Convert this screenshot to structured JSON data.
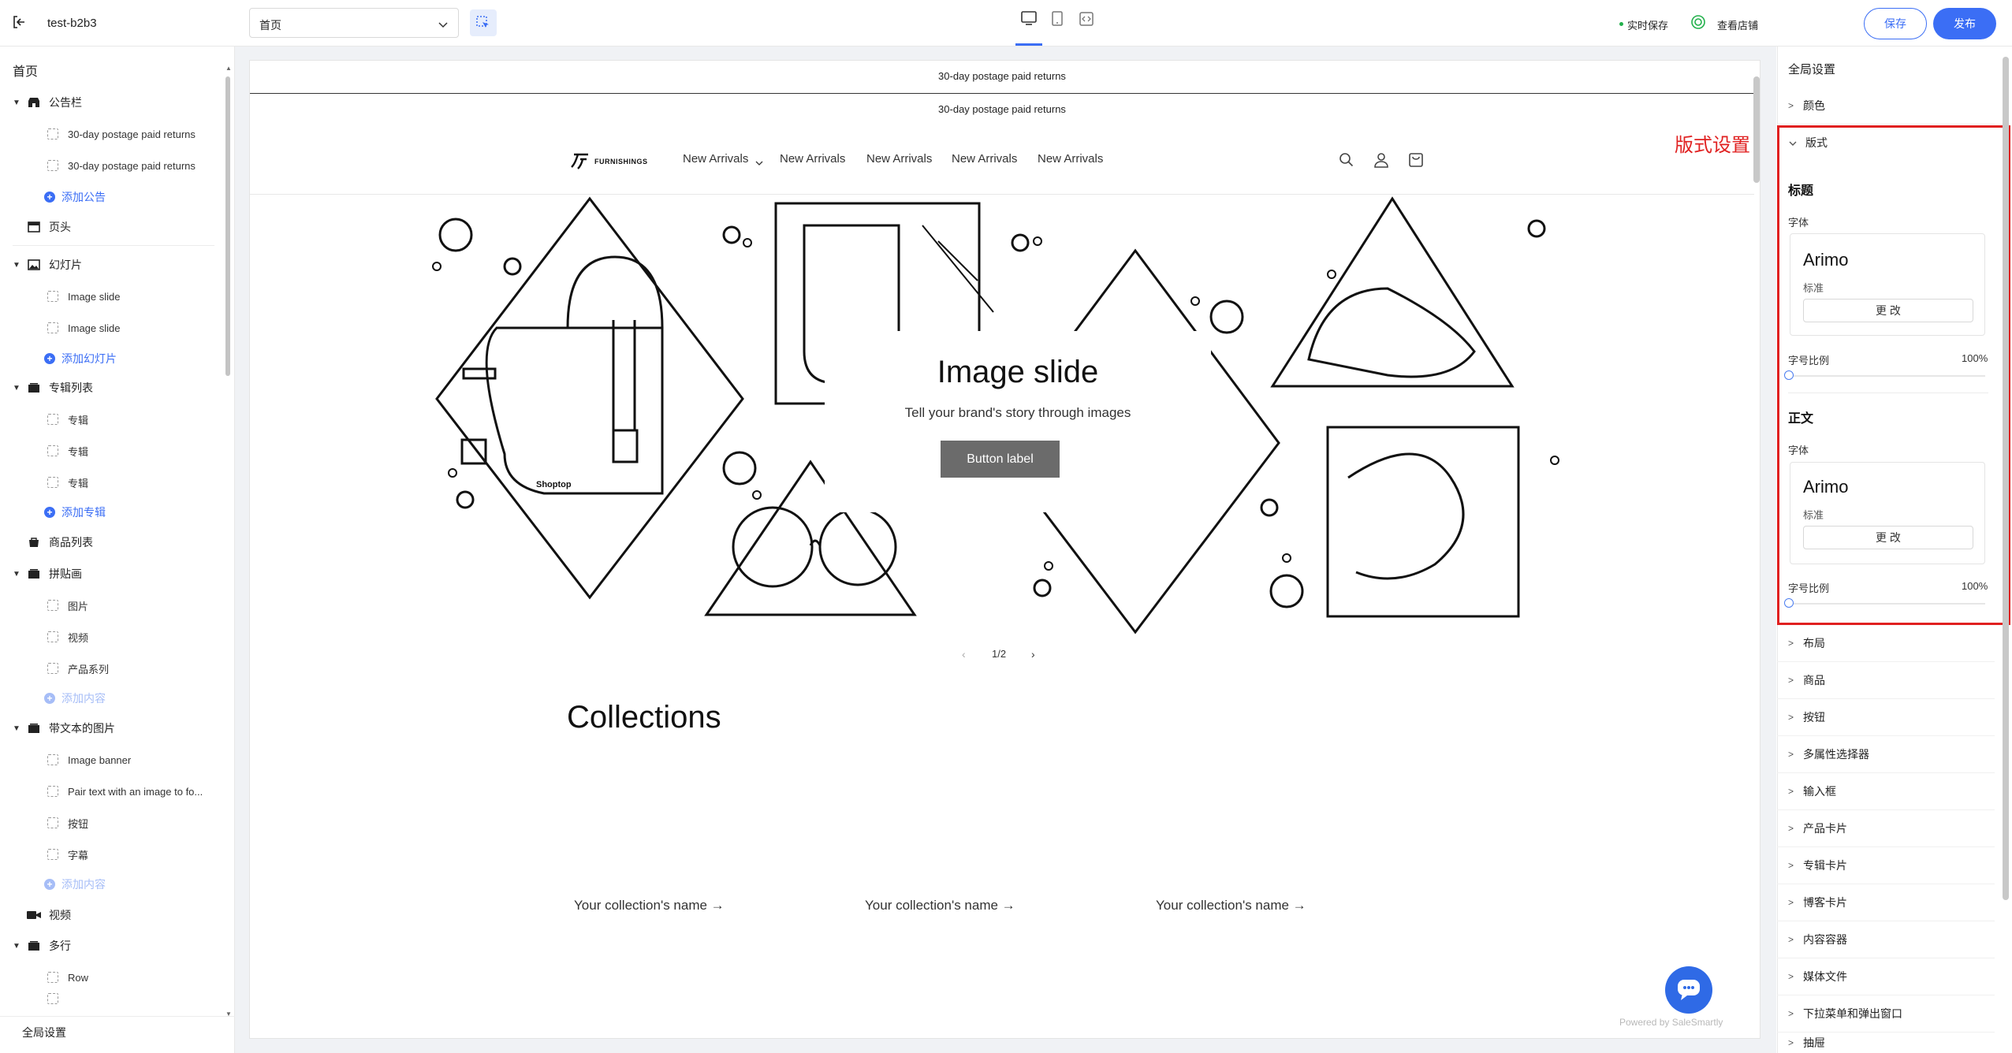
{
  "topbar": {
    "back_icon": "exit-icon",
    "store_name": "test-b2b3",
    "page_select_value": "首页",
    "autosave_label": "实时保存",
    "view_store_label": "查看店铺",
    "save_button": "保存",
    "publish_button": "发布",
    "device_modes": [
      "desktop",
      "tablet",
      "code"
    ]
  },
  "left": {
    "title": "首页",
    "tree": [
      {
        "label": "公告栏",
        "icon": "store-icon"
      },
      {
        "label": "30-day postage paid returns"
      },
      {
        "label": "30-day postage paid returns"
      },
      {
        "label": "添加公告"
      },
      {
        "label": "页头",
        "icon": "header-icon"
      },
      {
        "label": "幻灯片",
        "icon": "image-icon"
      },
      {
        "label": "Image slide"
      },
      {
        "label": "Image slide"
      },
      {
        "label": "添加幻灯片"
      },
      {
        "label": "专辑列表",
        "icon": "album-icon"
      },
      {
        "label": "专辑"
      },
      {
        "label": "专辑"
      },
      {
        "label": "专辑"
      },
      {
        "label": "添加专辑"
      },
      {
        "label": "商品列表",
        "icon": "product-icon"
      },
      {
        "label": "拼贴画",
        "icon": "collage-icon"
      },
      {
        "label": "图片"
      },
      {
        "label": "视频"
      },
      {
        "label": "产品系列"
      },
      {
        "label": "添加内容"
      },
      {
        "label": "带文本的图片",
        "icon": "image-text-icon"
      },
      {
        "label": "Image banner"
      },
      {
        "label": "Pair text with an image to fo..."
      },
      {
        "label": "按钮"
      },
      {
        "label": "字幕"
      },
      {
        "label": "添加内容"
      },
      {
        "label": "视频",
        "icon": "video-icon"
      },
      {
        "label": "多行",
        "icon": "multirow-icon"
      },
      {
        "label": "Row"
      }
    ],
    "footer": "全局设置"
  },
  "preview": {
    "announcement_1": "30-day postage paid returns",
    "announcement_2": "30-day postage paid returns",
    "logo_text": "FURNISHINGS",
    "nav": [
      "New Arrivals",
      "New Arrivals",
      "New Arrivals",
      "New Arrivals",
      "New Arrivals"
    ],
    "slide_title": "Image slide",
    "slide_subtitle": "Tell your brand's story through images",
    "slide_button": "Button label",
    "slide_label": "Shoptop",
    "pager": "1/2",
    "collections_title": "Collections",
    "collection_items": [
      "Your collection's name →",
      "Your collection's name →",
      "Your collection's name →"
    ],
    "powered": "Powered by SaleSmartly",
    "annotation": "版式设置"
  },
  "right": {
    "title": "全局设置",
    "sections_before": [
      "颜色"
    ],
    "expanded_section": "版式",
    "heading_group": "标题",
    "body_group": "正文",
    "font_label": "字体",
    "font_name": "Arimo",
    "font_weight": "标准",
    "change_button": "更 改",
    "scale_label": "字号比例",
    "scale_value": "100%",
    "sections_after": [
      "布局",
      "商品",
      "按钮",
      "多属性选择器",
      "输入框",
      "产品卡片",
      "专辑卡片",
      "博客卡片",
      "内容容器",
      "媒体文件",
      "下拉菜单和弹出窗口",
      "抽屉"
    ]
  },
  "colors": {
    "accent": "#3b6ef5",
    "annotation_red": "#e02020",
    "publish_bg": "#3b6ef5",
    "slide_button_bg": "#6b6b6b"
  }
}
